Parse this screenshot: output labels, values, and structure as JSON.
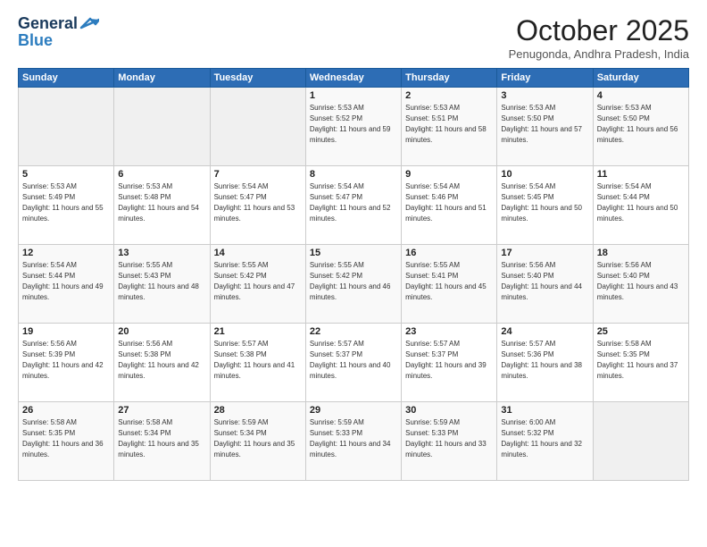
{
  "header": {
    "logo_line1": "General",
    "logo_line2": "Blue",
    "month": "October 2025",
    "location": "Penugonda, Andhra Pradesh, India"
  },
  "days_of_week": [
    "Sunday",
    "Monday",
    "Tuesday",
    "Wednesday",
    "Thursday",
    "Friday",
    "Saturday"
  ],
  "weeks": [
    [
      {
        "day": "",
        "info": ""
      },
      {
        "day": "",
        "info": ""
      },
      {
        "day": "",
        "info": ""
      },
      {
        "day": "1",
        "info": "Sunrise: 5:53 AM\nSunset: 5:52 PM\nDaylight: 11 hours and 59 minutes."
      },
      {
        "day": "2",
        "info": "Sunrise: 5:53 AM\nSunset: 5:51 PM\nDaylight: 11 hours and 58 minutes."
      },
      {
        "day": "3",
        "info": "Sunrise: 5:53 AM\nSunset: 5:50 PM\nDaylight: 11 hours and 57 minutes."
      },
      {
        "day": "4",
        "info": "Sunrise: 5:53 AM\nSunset: 5:50 PM\nDaylight: 11 hours and 56 minutes."
      }
    ],
    [
      {
        "day": "5",
        "info": "Sunrise: 5:53 AM\nSunset: 5:49 PM\nDaylight: 11 hours and 55 minutes."
      },
      {
        "day": "6",
        "info": "Sunrise: 5:53 AM\nSunset: 5:48 PM\nDaylight: 11 hours and 54 minutes."
      },
      {
        "day": "7",
        "info": "Sunrise: 5:54 AM\nSunset: 5:47 PM\nDaylight: 11 hours and 53 minutes."
      },
      {
        "day": "8",
        "info": "Sunrise: 5:54 AM\nSunset: 5:47 PM\nDaylight: 11 hours and 52 minutes."
      },
      {
        "day": "9",
        "info": "Sunrise: 5:54 AM\nSunset: 5:46 PM\nDaylight: 11 hours and 51 minutes."
      },
      {
        "day": "10",
        "info": "Sunrise: 5:54 AM\nSunset: 5:45 PM\nDaylight: 11 hours and 50 minutes."
      },
      {
        "day": "11",
        "info": "Sunrise: 5:54 AM\nSunset: 5:44 PM\nDaylight: 11 hours and 50 minutes."
      }
    ],
    [
      {
        "day": "12",
        "info": "Sunrise: 5:54 AM\nSunset: 5:44 PM\nDaylight: 11 hours and 49 minutes."
      },
      {
        "day": "13",
        "info": "Sunrise: 5:55 AM\nSunset: 5:43 PM\nDaylight: 11 hours and 48 minutes."
      },
      {
        "day": "14",
        "info": "Sunrise: 5:55 AM\nSunset: 5:42 PM\nDaylight: 11 hours and 47 minutes."
      },
      {
        "day": "15",
        "info": "Sunrise: 5:55 AM\nSunset: 5:42 PM\nDaylight: 11 hours and 46 minutes."
      },
      {
        "day": "16",
        "info": "Sunrise: 5:55 AM\nSunset: 5:41 PM\nDaylight: 11 hours and 45 minutes."
      },
      {
        "day": "17",
        "info": "Sunrise: 5:56 AM\nSunset: 5:40 PM\nDaylight: 11 hours and 44 minutes."
      },
      {
        "day": "18",
        "info": "Sunrise: 5:56 AM\nSunset: 5:40 PM\nDaylight: 11 hours and 43 minutes."
      }
    ],
    [
      {
        "day": "19",
        "info": "Sunrise: 5:56 AM\nSunset: 5:39 PM\nDaylight: 11 hours and 42 minutes."
      },
      {
        "day": "20",
        "info": "Sunrise: 5:56 AM\nSunset: 5:38 PM\nDaylight: 11 hours and 42 minutes."
      },
      {
        "day": "21",
        "info": "Sunrise: 5:57 AM\nSunset: 5:38 PM\nDaylight: 11 hours and 41 minutes."
      },
      {
        "day": "22",
        "info": "Sunrise: 5:57 AM\nSunset: 5:37 PM\nDaylight: 11 hours and 40 minutes."
      },
      {
        "day": "23",
        "info": "Sunrise: 5:57 AM\nSunset: 5:37 PM\nDaylight: 11 hours and 39 minutes."
      },
      {
        "day": "24",
        "info": "Sunrise: 5:57 AM\nSunset: 5:36 PM\nDaylight: 11 hours and 38 minutes."
      },
      {
        "day": "25",
        "info": "Sunrise: 5:58 AM\nSunset: 5:35 PM\nDaylight: 11 hours and 37 minutes."
      }
    ],
    [
      {
        "day": "26",
        "info": "Sunrise: 5:58 AM\nSunset: 5:35 PM\nDaylight: 11 hours and 36 minutes."
      },
      {
        "day": "27",
        "info": "Sunrise: 5:58 AM\nSunset: 5:34 PM\nDaylight: 11 hours and 35 minutes."
      },
      {
        "day": "28",
        "info": "Sunrise: 5:59 AM\nSunset: 5:34 PM\nDaylight: 11 hours and 35 minutes."
      },
      {
        "day": "29",
        "info": "Sunrise: 5:59 AM\nSunset: 5:33 PM\nDaylight: 11 hours and 34 minutes."
      },
      {
        "day": "30",
        "info": "Sunrise: 5:59 AM\nSunset: 5:33 PM\nDaylight: 11 hours and 33 minutes."
      },
      {
        "day": "31",
        "info": "Sunrise: 6:00 AM\nSunset: 5:32 PM\nDaylight: 11 hours and 32 minutes."
      },
      {
        "day": "",
        "info": ""
      }
    ]
  ]
}
